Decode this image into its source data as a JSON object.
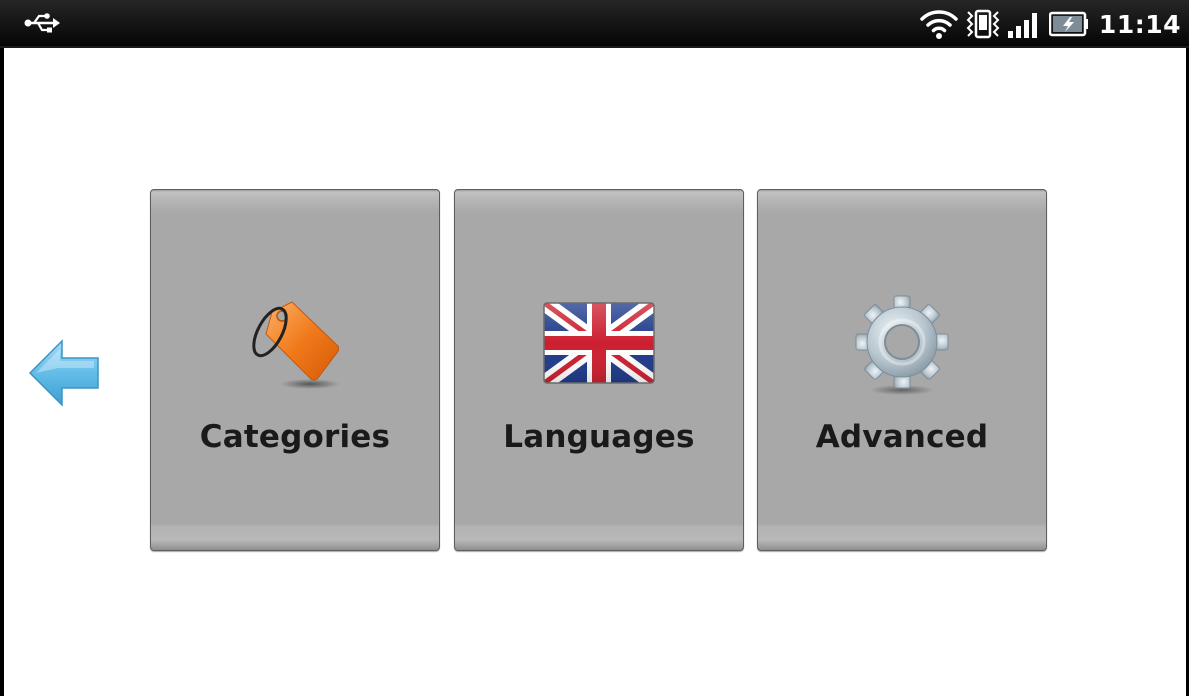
{
  "status_bar": {
    "time": "11:14",
    "icons": [
      "usb-icon",
      "wifi-icon",
      "vibrate-icon",
      "signal-icon",
      "battery-charging-icon"
    ]
  },
  "navigation": {
    "back_icon": "back-arrow-icon"
  },
  "tiles": [
    {
      "label": "Categories",
      "icon": "tag-icon"
    },
    {
      "label": "Languages",
      "icon": "uk-flag-icon"
    },
    {
      "label": "Advanced",
      "icon": "gear-icon"
    }
  ],
  "colors": {
    "status_bar_bg": "#111111",
    "tile_bg": "#a8a8a8",
    "tile_border": "#5e5e5e",
    "label_text": "#1a1a1a",
    "back_arrow": "#5bb7e3",
    "tag": "#f07a1a"
  }
}
